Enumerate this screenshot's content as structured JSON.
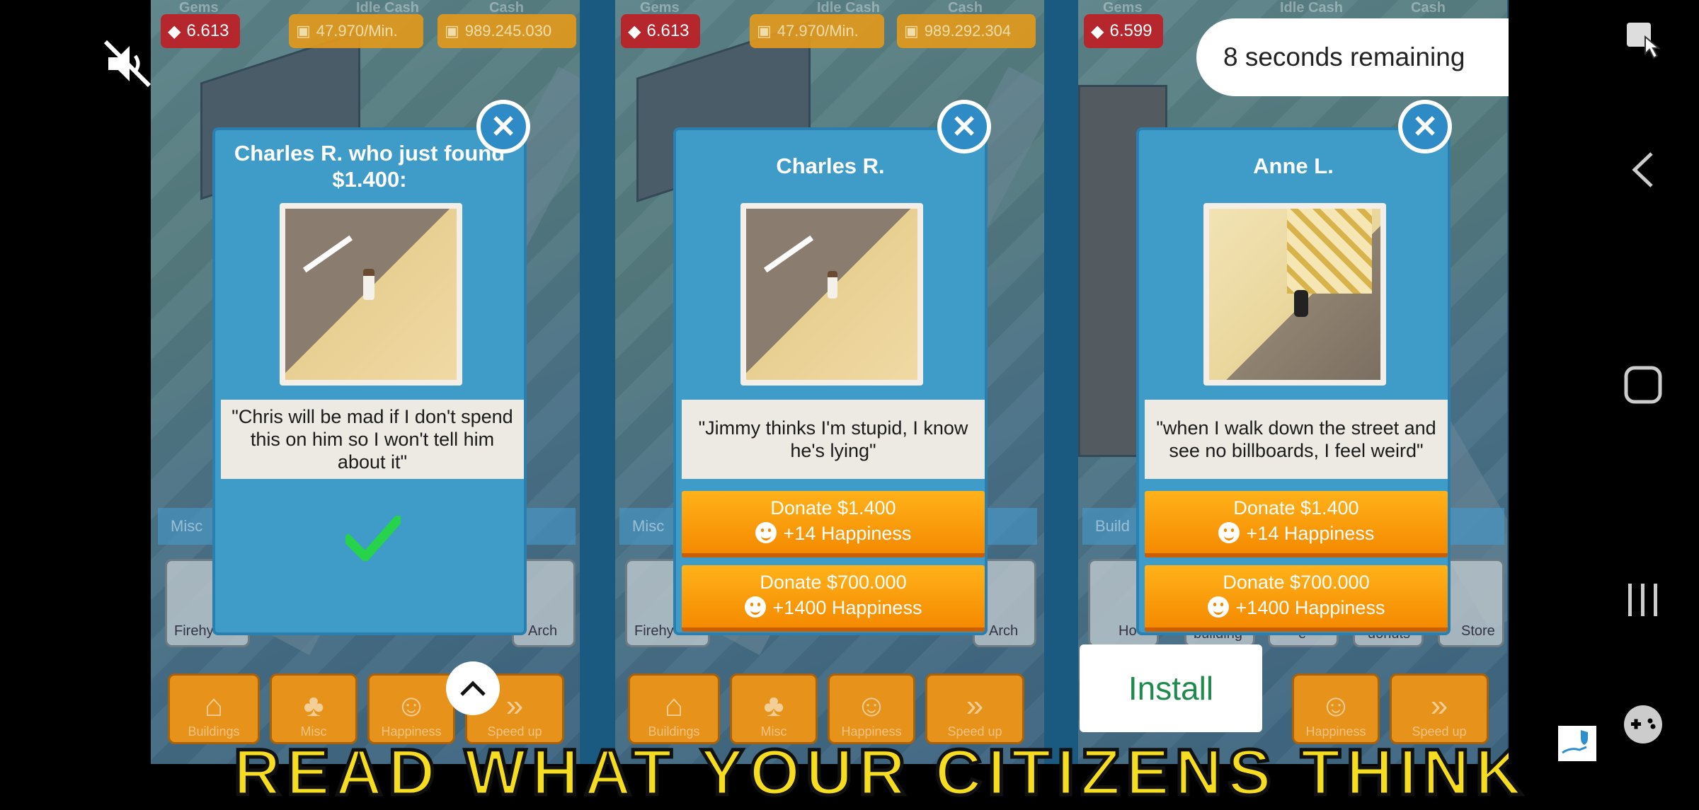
{
  "ad": {
    "timer_text": "8 seconds remaining",
    "install_label": "Install",
    "banner_text": "READ WHAT YOUR CITIZENS THINK"
  },
  "panels": [
    {
      "hud": {
        "gems_label": "Gems",
        "idle_cash_label": "Idle Cash",
        "cash_label": "Cash",
        "gems": "6.613",
        "idle_cash": "47.970/Min.",
        "cash": "989.245.030"
      },
      "misc_label": "Misc",
      "slot_labels": [
        "Firehy",
        "Arch"
      ],
      "nav_labels": [
        "Buildings",
        "Misc",
        "Happiness",
        "Speed up"
      ],
      "dialog": {
        "title": "Charles R. who just found $1.400:",
        "quote": "\"Chris will be mad if I don't spend this on him so I won't tell him about it\"",
        "state": "donated"
      }
    },
    {
      "hud": {
        "gems_label": "Gems",
        "idle_cash_label": "Idle Cash",
        "cash_label": "Cash",
        "gems": "6.613",
        "idle_cash": "47.970/Min.",
        "cash": "989.292.304"
      },
      "misc_label": "Misc",
      "slot_labels": [
        "Firehy",
        "Arch"
      ],
      "nav_labels": [
        "Buildings",
        "Misc",
        "Happiness",
        "Speed up"
      ],
      "dialog": {
        "title": "Charles R.",
        "quote": "\"Jimmy thinks I'm stupid, I know he's lying\"",
        "donate_small_amount": "Donate $1.400",
        "donate_small_reward": "+14 Happiness",
        "donate_large_amount": "Donate $700.000",
        "donate_large_reward": "+1400 Happiness"
      }
    },
    {
      "hud": {
        "gems_label": "Gems",
        "idle_cash_label": "Idle Cash",
        "cash_label": "Cash",
        "gems": "6.599"
      },
      "misc_label": "Build",
      "slot_labels": [
        "Ho",
        "building",
        "e",
        "donuts",
        "Store"
      ],
      "nav_labels": [
        "Happiness",
        "Speed up"
      ],
      "dialog": {
        "title": "Anne L.",
        "quote": "\"when I walk down the street and see no billboards, I feel weird\"",
        "donate_small_amount": "Donate $1.400",
        "donate_small_reward": "+14 Happiness",
        "donate_large_amount": "Donate $700.000",
        "donate_large_reward": "+1400 Happiness"
      }
    }
  ],
  "colors": {
    "dialog": "#3f9bc8",
    "donate": "#f58a00",
    "gem_box": "#b6262d",
    "install_text": "#1e8a4c"
  },
  "icons": [
    "muted-speaker-icon",
    "close-x-icon",
    "checkmark-icon",
    "smiley-icon",
    "chevron-up-icon",
    "screenshot-pointer-icon",
    "back-icon",
    "home-icon",
    "recents-icon",
    "game-controller-icon",
    "protection-icon"
  ]
}
